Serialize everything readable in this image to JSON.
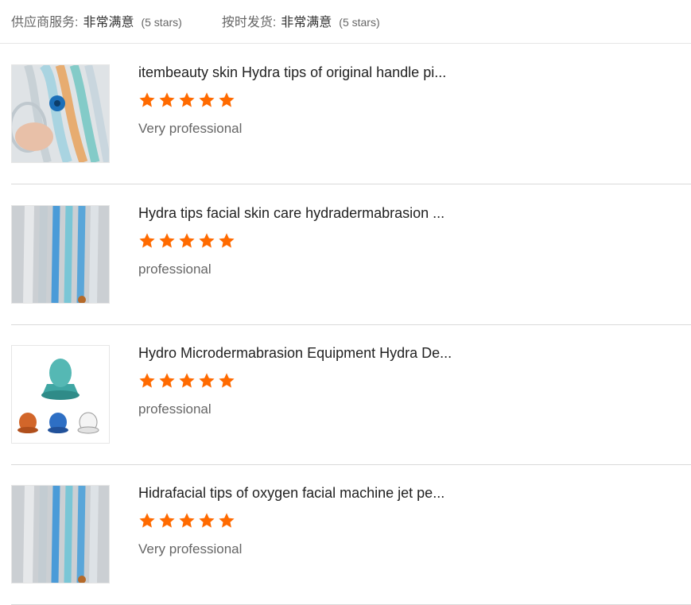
{
  "summary": {
    "supplier_service": {
      "label": "供应商服务:",
      "value": "非常满意",
      "stars": "(5 stars)"
    },
    "on_time_delivery": {
      "label": "按时发货:",
      "value": "非常满意",
      "stars": "(5 stars)"
    }
  },
  "colors": {
    "star": "#ff6a00",
    "divider": "#d9d9d9"
  },
  "reviews": [
    {
      "title": "itembeauty skin Hydra tips of original handle pi...",
      "rating": 5,
      "comment": "Very professional",
      "image_icon": "hydra-handle-product-photo"
    },
    {
      "title": "Hydra tips facial skin care hydradermabrasion ...",
      "rating": 5,
      "comment": "professional",
      "image_icon": "hydra-tips-bags-photo"
    },
    {
      "title": "Hydro Microdermabrasion Equipment Hydra De...",
      "rating": 5,
      "comment": "professional",
      "image_icon": "hydra-tip-heads-photo"
    },
    {
      "title": "Hidrafacial tips of oxygen facial machine jet pe...",
      "rating": 5,
      "comment": "Very professional",
      "image_icon": "hydra-tips-bags-photo"
    }
  ]
}
